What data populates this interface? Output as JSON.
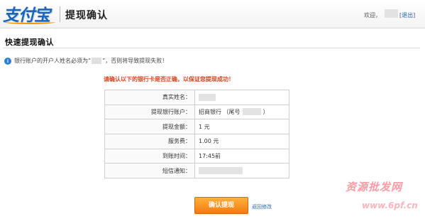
{
  "header": {
    "logo_text": "支付宝",
    "title": "提现确认",
    "welcome": "欢迎，",
    "logout": "退出"
  },
  "section": {
    "title": "快速提现确认",
    "notice_prefix": "银行账户的开户人姓名必须为“",
    "notice_suffix": "”，否则将导致提现失败！",
    "warning": "请确认以下的银行卡是否正确，以保证您提现成功！"
  },
  "details": [
    {
      "label": "真实姓名：",
      "value": ""
    },
    {
      "label": "提现银行账户：",
      "value": "招商银行 （尾号",
      "suffix": "）"
    },
    {
      "label": "提现金额：",
      "value": "1 元"
    },
    {
      "label": "服务费：",
      "value": "1.00 元"
    },
    {
      "label": "到账时间：",
      "value": "17:45前"
    },
    {
      "label": "短信通知：",
      "value": ""
    }
  ],
  "actions": {
    "confirm": "确认提现",
    "back": "返回修改"
  },
  "watermark": {
    "title": "资源批发网",
    "url": "www.6pf.cn"
  },
  "colors": {
    "brand_blue": "#1b66b8",
    "warning_red": "#e0401a",
    "button_orange": "#f37a12"
  }
}
